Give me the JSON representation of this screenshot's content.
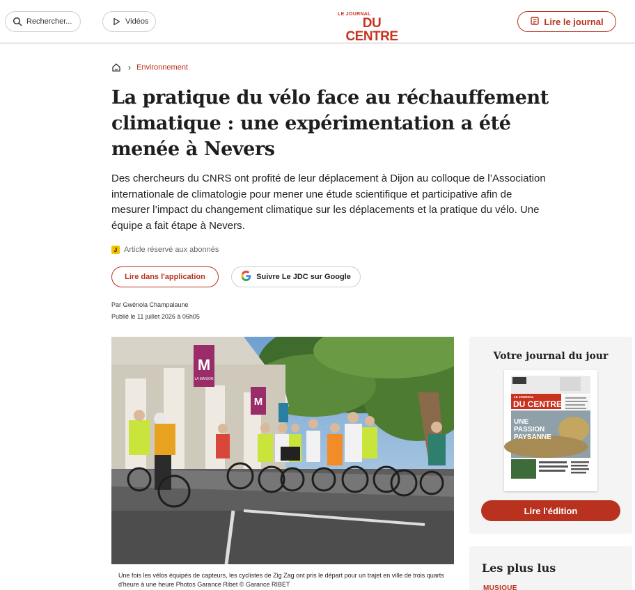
{
  "header": {
    "search_label": "Rechercher...",
    "videos_label": "Vidéos",
    "logo_small": "LE JOURNAL",
    "logo_big": "DU CENTRE",
    "read_journal_label": "Lire le journal"
  },
  "breadcrumb": {
    "category": "Environnement"
  },
  "article": {
    "title": "La pratique du vélo face au réchauffement climatique : une expérimentation a été menée à Nevers",
    "lead": "Des chercheurs du CNRS ont profité de leur déplacement à Dijon au colloque de l’Association internationale de climatologie pour mener une étude scientifique et participative afin de mesurer l’impact du changement climatique sur les déplacements et la pratique du vélo. Une équipe a fait étape à Nevers.",
    "subscriber_badge": "J",
    "subscriber_label": "Article réservé aux abonnés",
    "app_button": "Lire dans l'application",
    "google_button": "Suivre Le JDC sur Google",
    "author": "Par Gwénola Champalaune",
    "published": "Publié le 11 juillet 2026 à 06h05",
    "photo_sign_1": "LA MAISON",
    "photo_sign_2": "Sign",
    "caption": "Une fois les vélos équipés de capteurs, les cyclistes de Zig Zag ont pris le départ pour un trajet en ville de trois quarts d'heure à une heure Photos Garance Ribet © Garance RIBET"
  },
  "sidebar": {
    "journal_title": "Votre journal du jour",
    "cover_logo_small": "LE JOURNAL",
    "cover_logo_big": "DU CENTRE",
    "cover_headline_1": "UNE",
    "cover_headline_2": "PASSION",
    "cover_headline_3": "PAYSANNE",
    "edition_button": "Lire l'édition",
    "most_read_title": "Les plus lus",
    "most_read_tag": "MUSIQUE"
  },
  "colors": {
    "brand_red": "#b8321f",
    "badge_yellow": "#f2c200"
  }
}
